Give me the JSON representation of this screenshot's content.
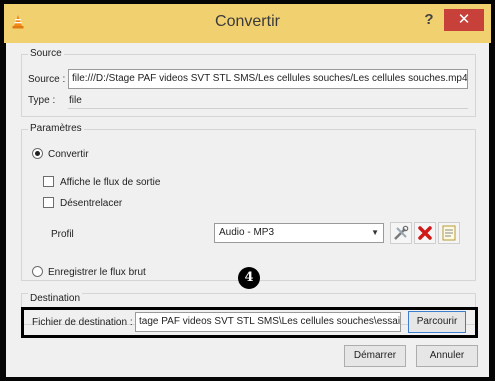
{
  "window": {
    "title": "Convertir",
    "help_label": "?",
    "close_label": "✕",
    "app_icon": "vlc-cone-icon"
  },
  "source": {
    "group_label": "Source",
    "source_label": "Source :",
    "source_value": "file:///D:/Stage PAF videos SVT STL SMS/Les cellules souches/Les cellules souches.mp4",
    "type_label": "Type :",
    "type_value": "file"
  },
  "params": {
    "group_label": "Paramètres",
    "convert_label": "Convertir",
    "convert_selected": true,
    "show_output_label": "Affiche le flux de sortie",
    "show_output_checked": false,
    "deinterlace_label": "Désentrelacer",
    "deinterlace_checked": false,
    "profile_label": "Profil",
    "profile_value": "Audio - MP3",
    "profile_icons": [
      "edit-profile-icon",
      "delete-profile-icon",
      "new-profile-icon"
    ],
    "raw_dump_label": "Enregistrer le flux brut",
    "raw_dump_selected": false
  },
  "destination": {
    "group_label": "Destination",
    "file_label": "Fichier de destination :",
    "file_value": "tage PAF videos SVT STL SMS\\Les cellules souches\\essai.wav",
    "browse_label": "Parcourir"
  },
  "annotation": {
    "step_number": "4"
  },
  "footer": {
    "start_label": "Démarrer",
    "cancel_label": "Annuler"
  },
  "colors": {
    "titlebar": "#f1d070",
    "close_button": "#c7413a",
    "dialog_bg": "#f0f0f0",
    "focus_border": "#3c7fd0"
  }
}
